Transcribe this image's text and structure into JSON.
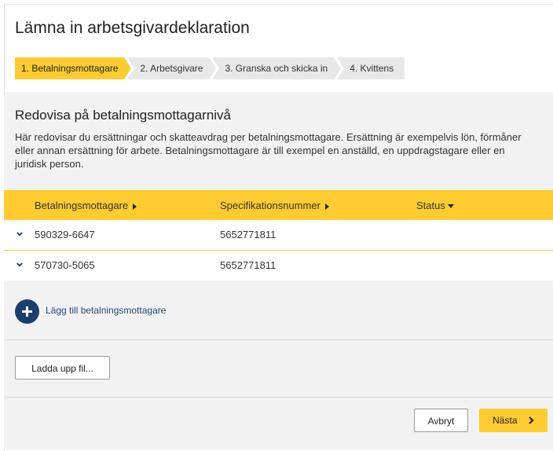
{
  "page": {
    "title": "Lämna in arbetsgivardeklaration"
  },
  "steps": [
    {
      "label": "1. Betalningsmottagare",
      "active": true
    },
    {
      "label": "2. Arbetsgivare",
      "active": false
    },
    {
      "label": "3. Granska och skicka in",
      "active": false
    },
    {
      "label": "4. Kvittens",
      "active": false
    }
  ],
  "section": {
    "heading": "Redovisa på betalningsmottagarnivå",
    "description": "Här redovisar du ersättningar och skatteavdrag per betalningsmottagare. Ersättning är exempelvis lön, förmåner eller annan ersättning för arbete. Betalningsmottagare är till exempel en anställd, en uppdragstagare eller en juridisk person."
  },
  "table": {
    "columns": [
      "Betalningsmottagare",
      "Specifikationsnummer",
      "Status"
    ],
    "rows": [
      {
        "recipient": "590329-6647",
        "spec": "5652771811",
        "status": ""
      },
      {
        "recipient": "570730-5065",
        "spec": "5652771811",
        "status": ""
      }
    ]
  },
  "actions": {
    "add_recipient": "Lägg till betalningsmottagare",
    "upload": "Ladda upp fil...",
    "cancel": "Avbryt",
    "next": "Nästa"
  },
  "colors": {
    "accent": "#fecc2f",
    "navy": "#1a3f6d",
    "link": "#1f4a7d"
  }
}
